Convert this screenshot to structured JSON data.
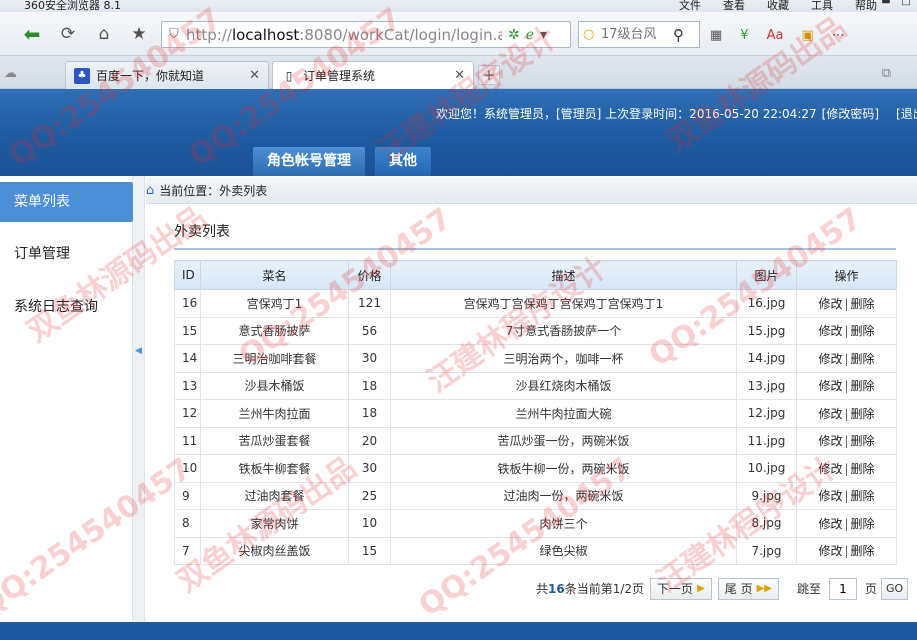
{
  "browser": {
    "app_title": "360安全浏览器 8.1",
    "menu": [
      "文件",
      "查看",
      "收藏",
      "工具",
      "帮助"
    ],
    "url_gray_prefix": "http://",
    "url_host": "localhost",
    "url_rest": ":8080/workCat/login/login.ac",
    "search_placeholder": "17级台风",
    "tabs": [
      {
        "label": "百度一下，你就知道",
        "icon": "baidu-paw-icon"
      },
      {
        "label": "订单管理系统",
        "icon": "page-icon"
      }
    ]
  },
  "header": {
    "welcome": "欢迎您！系统管理员，[管理员] 上次登录时间：2016-05-20 22:04:27",
    "change_password": "[修改密码]",
    "logout": "[退出系统]",
    "main_tabs": [
      "角色帐号管理",
      "其他"
    ]
  },
  "sidebar": {
    "items": [
      "菜单列表",
      "订单管理",
      "系统日志查询"
    ]
  },
  "breadcrumb": "当前位置：外卖列表",
  "content": {
    "title": "外卖列表",
    "columns": [
      "ID",
      "菜名",
      "价格",
      "描述",
      "图片",
      "操作"
    ],
    "edit_label": "修改",
    "delete_label": "删除",
    "rows": [
      {
        "id": "16",
        "name": "宫保鸡丁1",
        "price": "121",
        "desc": "宫保鸡丁宫保鸡丁宫保鸡丁宫保鸡丁1",
        "image": "16.jpg"
      },
      {
        "id": "15",
        "name": "意式香肠披萨",
        "price": "56",
        "desc": "7寸意式香肠披萨一个",
        "image": "15.jpg"
      },
      {
        "id": "14",
        "name": "三明治咖啡套餐",
        "price": "30",
        "desc": "三明治两个，咖啡一杯",
        "image": "14.jpg"
      },
      {
        "id": "13",
        "name": "沙县木桶饭",
        "price": "18",
        "desc": "沙县红烧肉木桶饭",
        "image": "13.jpg"
      },
      {
        "id": "12",
        "name": "兰州牛肉拉面",
        "price": "18",
        "desc": "兰州牛肉拉面大碗",
        "image": "12.jpg"
      },
      {
        "id": "11",
        "name": "苦瓜炒蛋套餐",
        "price": "20",
        "desc": "苦瓜炒蛋一份，两碗米饭",
        "image": "11.jpg"
      },
      {
        "id": "10",
        "name": "铁板牛柳套餐",
        "price": "30",
        "desc": "铁板牛柳一份，两碗米饭",
        "image": "10.jpg"
      },
      {
        "id": "9",
        "name": "过油肉套餐",
        "price": "25",
        "desc": "过油肉一份，两碗米饭",
        "image": "9.jpg"
      },
      {
        "id": "8",
        "name": "家常肉饼",
        "price": "10",
        "desc": "肉饼三个",
        "image": "8.jpg"
      },
      {
        "id": "7",
        "name": "尖椒肉丝盖饭",
        "price": "15",
        "desc": "绿色尖椒",
        "image": "7.jpg"
      }
    ]
  },
  "pager": {
    "prefix": "共",
    "total": "16",
    "suffix": "条当前第1/2页",
    "next": "下一页",
    "last": "尾 页",
    "jump_label": "跳至",
    "page_value": "1",
    "page_unit": "页",
    "go": "GO"
  },
  "watermarks": [
    "QQ:254540457",
    "汪建林程序设计",
    "双鱼林源码出品"
  ],
  "colors": {
    "header_blue": "#1e5aa0",
    "sidebar_active": "#4a8fd8",
    "watermark_red": "#e62828"
  }
}
